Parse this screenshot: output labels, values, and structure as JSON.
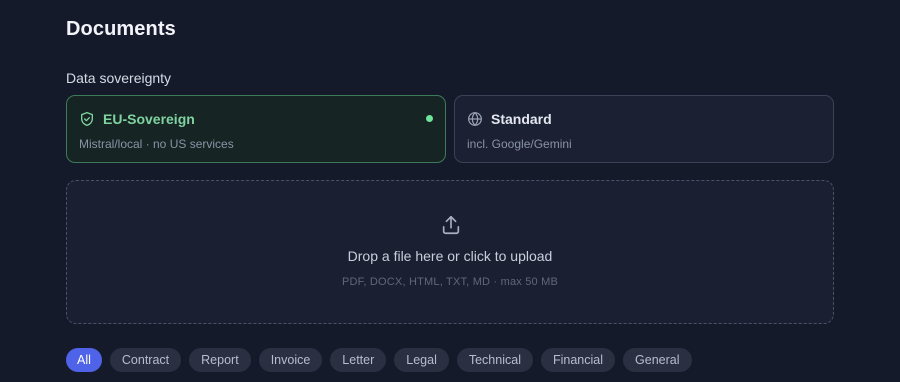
{
  "header": {
    "title": "Documents"
  },
  "sovereignty": {
    "label": "Data sovereignty",
    "options": [
      {
        "name": "EU-Sovereign",
        "description": "Mistral/local · no US services",
        "icon": "shield-check-icon",
        "selected": true
      },
      {
        "name": "Standard",
        "description": "incl. Google/Gemini",
        "icon": "globe-icon",
        "selected": false
      }
    ],
    "accent_color": "#6ee59a"
  },
  "upload": {
    "icon": "upload-icon",
    "main_text": "Drop a file here or click to upload",
    "sub_text": "PDF, DOCX, HTML, TXT, MD · max 50 MB"
  },
  "filters": {
    "active": "All",
    "active_color": "#4f63e8",
    "items": [
      "All",
      "Contract",
      "Report",
      "Invoice",
      "Letter",
      "Legal",
      "Technical",
      "Financial",
      "General"
    ]
  }
}
